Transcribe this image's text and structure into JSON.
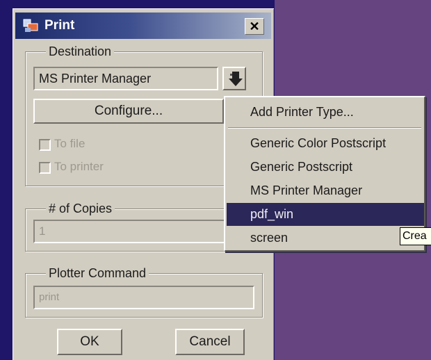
{
  "window": {
    "title": "Print",
    "close_label": "✕"
  },
  "destination": {
    "legend": "Destination",
    "printer_value": "MS Printer Manager",
    "configure_label": "Configure...",
    "to_file_label": "To file",
    "to_printer_label": "To printer"
  },
  "copies": {
    "legend": "# of Copies",
    "value": "1"
  },
  "plotter": {
    "legend": "Plotter Command",
    "value": "print"
  },
  "buttons": {
    "ok_label": "OK",
    "cancel_label": "Cancel"
  },
  "printer_menu": {
    "add_label": "Add Printer Type...",
    "items": [
      "Generic Color Postscript",
      "Generic Postscript",
      "MS Printer Manager",
      "pdf_win",
      "screen"
    ],
    "selected": "pdf_win"
  },
  "tooltip": {
    "text": "Crea"
  },
  "colors": {
    "desktop_left": "#1f1569",
    "desktop_right": "#65447f",
    "dialog_face": "#d2cdc1",
    "menu_selection": "#2b2758"
  }
}
